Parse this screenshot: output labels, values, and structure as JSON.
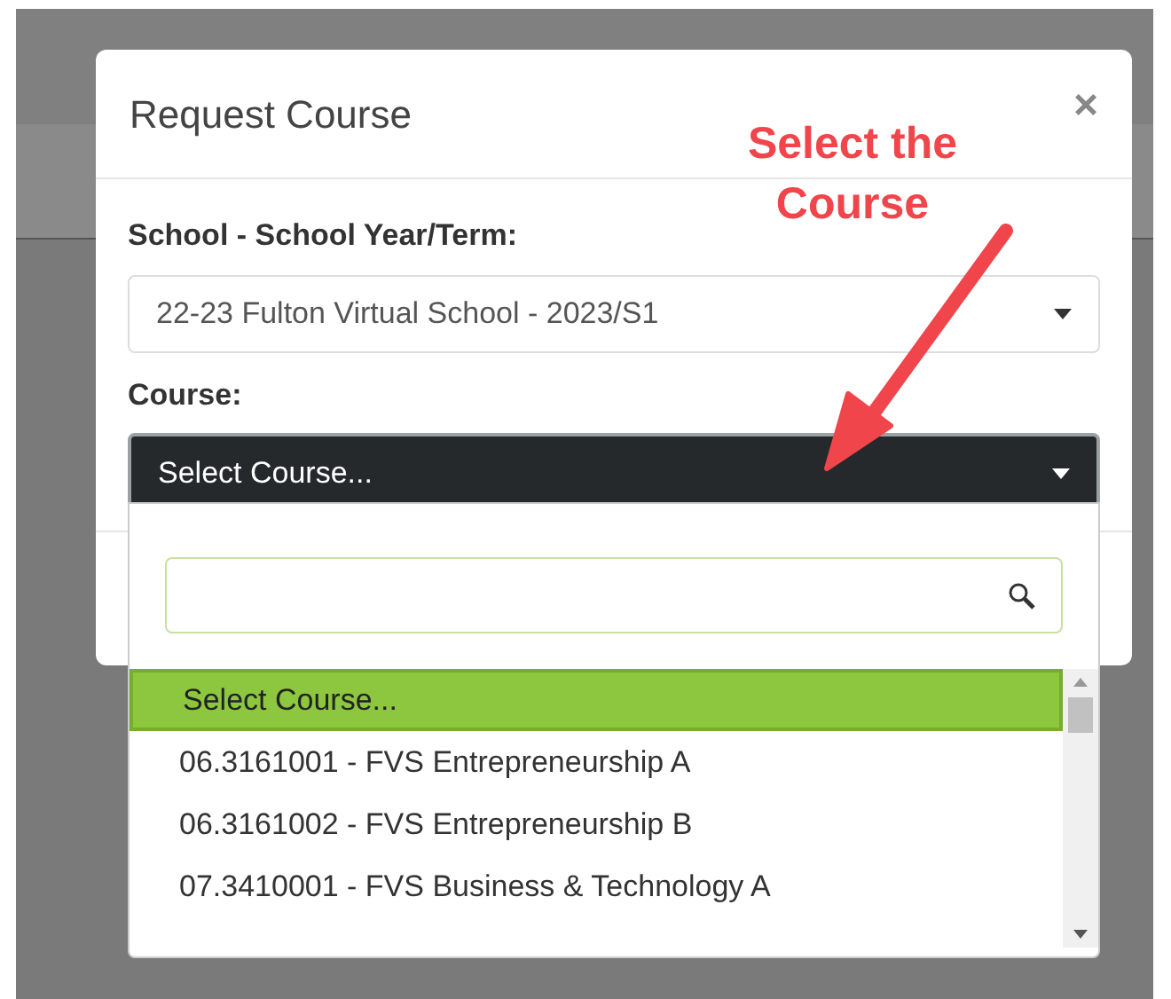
{
  "dialog": {
    "title": "Request Course",
    "close": "×",
    "fields": [
      {
        "label": "School - School Year/Term:",
        "value": "22-23 Fulton Virtual School - 2023/S1",
        "focused": false
      },
      {
        "label": "Course:",
        "value": "Select Course...",
        "focused": true
      }
    ]
  },
  "dropdown": {
    "options": [
      {
        "label": "Select Course...",
        "selected": true
      },
      {
        "label": "06.3161001 - FVS Entrepreneurship A",
        "selected": false
      },
      {
        "label": "06.3161002 - FVS Entrepreneurship B",
        "selected": false
      },
      {
        "label": "07.3410001 - FVS Business & Technology A",
        "selected": false
      }
    ]
  },
  "annotation": {
    "text": "Select the Course"
  }
}
